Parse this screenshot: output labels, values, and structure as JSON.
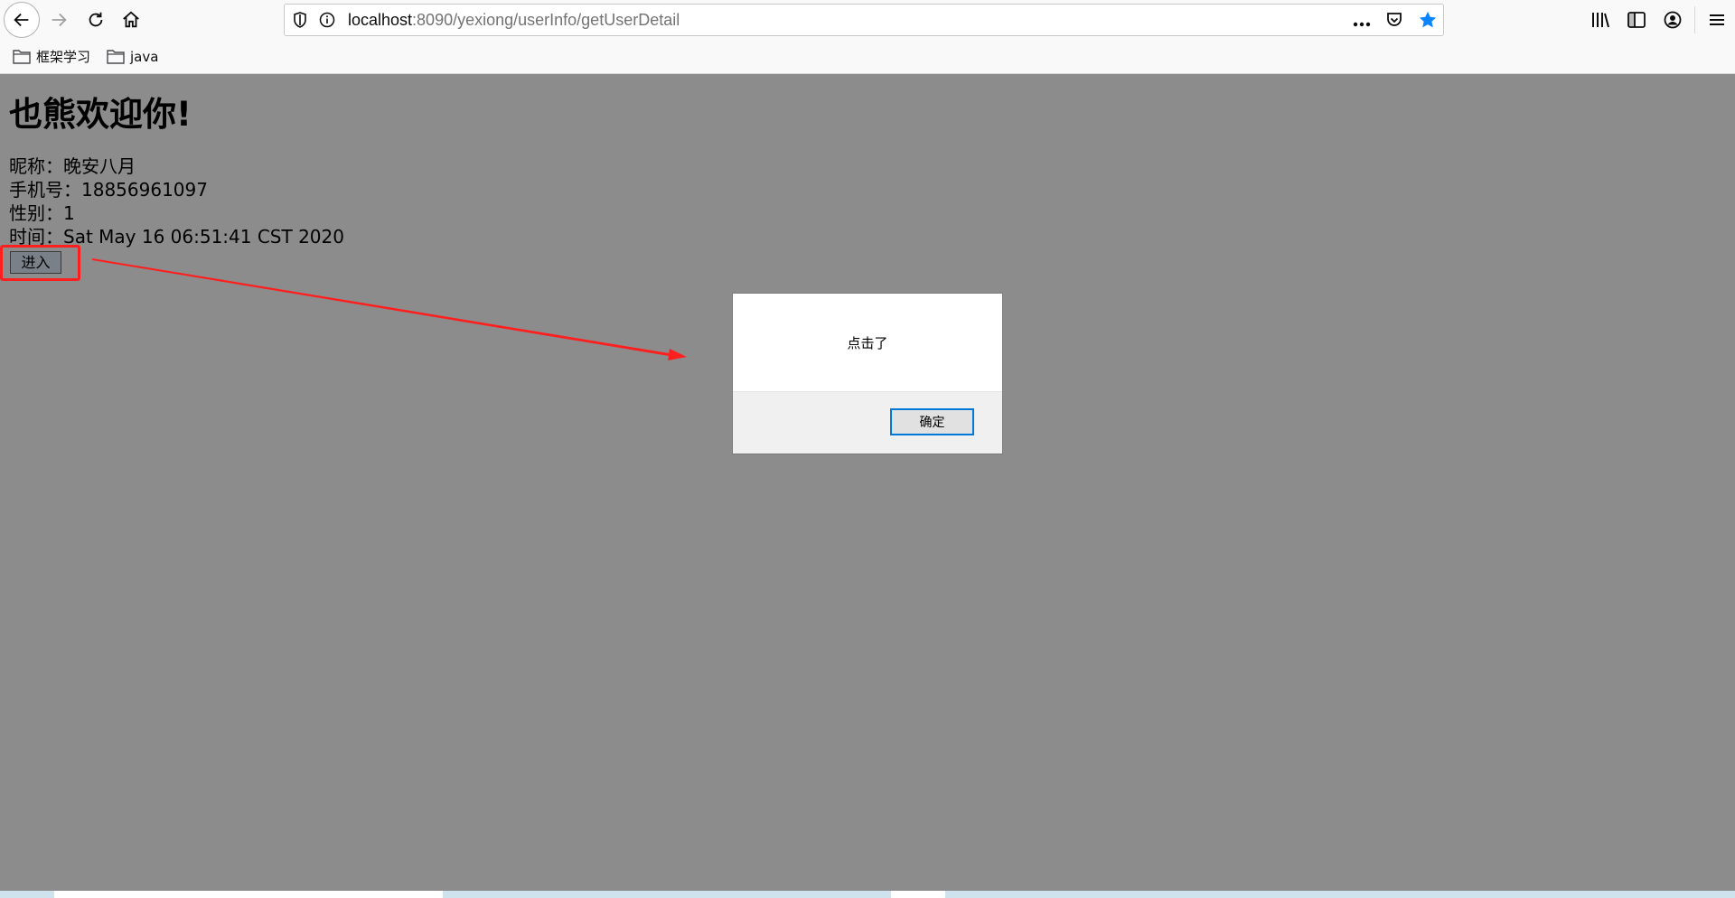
{
  "browser": {
    "url_host": "localhost",
    "url_path": ":8090/yexiong/userInfo/getUserDetail",
    "bookmarks": [
      {
        "label": "框架学习"
      },
      {
        "label": "java"
      }
    ]
  },
  "page": {
    "title": "也熊欢迎你!",
    "nickname_line": "昵称：晚安八月",
    "phone_line": "手机号：18856961097",
    "gender_line": "性别：1",
    "time_line": "时间：Sat May 16 06:51:41 CST 2020",
    "enter_button": "进入"
  },
  "dialog": {
    "message": "点击了",
    "ok_label": "确定"
  },
  "colors": {
    "overlay": "#8c8c8c",
    "annotation": "#ff1f1f",
    "dialog_focus": "#0078d7",
    "bookmark_star": "#0a84ff"
  }
}
